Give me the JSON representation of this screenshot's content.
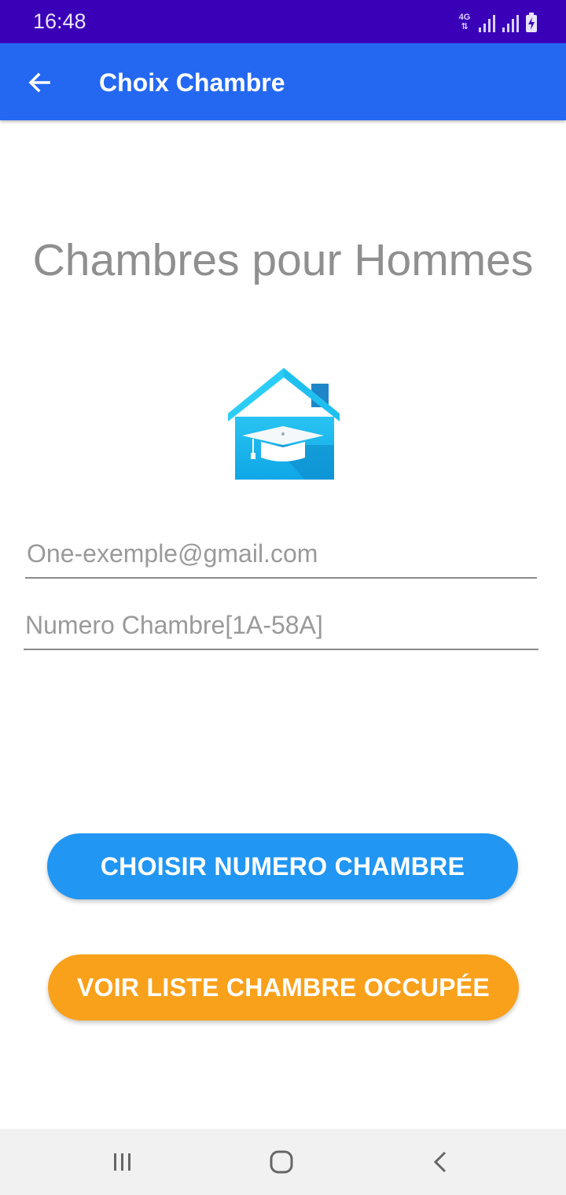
{
  "status_bar": {
    "time": "16:48",
    "network": "4G",
    "icons": [
      "network-4g-icon",
      "signal-icon",
      "signal-icon",
      "battery-charging-icon"
    ]
  },
  "app_bar": {
    "title": "Choix Chambre",
    "back_icon": "arrow-left-icon",
    "color": "#2468F2"
  },
  "main": {
    "heading": "Chambres pour Hommes",
    "logo_icon": "house-graduation-cap-icon",
    "email_placeholder": "One-exemple@gmail.com",
    "email_value": "",
    "room_placeholder": "Numero Chambre[1A-58A]",
    "room_value": ""
  },
  "buttons": {
    "choose_label": "CHOISIR NUMERO CHAMBRE",
    "choose_color": "#2196F3",
    "list_label": "VOIR LISTE CHAMBRE OCCUPÉE",
    "list_color": "#F9A11B"
  },
  "nav_bar": {
    "items": [
      "recents-icon",
      "home-icon",
      "back-icon"
    ]
  },
  "colors": {
    "status_bar": "#3A00B8",
    "heading_text": "#8f8f8f"
  }
}
